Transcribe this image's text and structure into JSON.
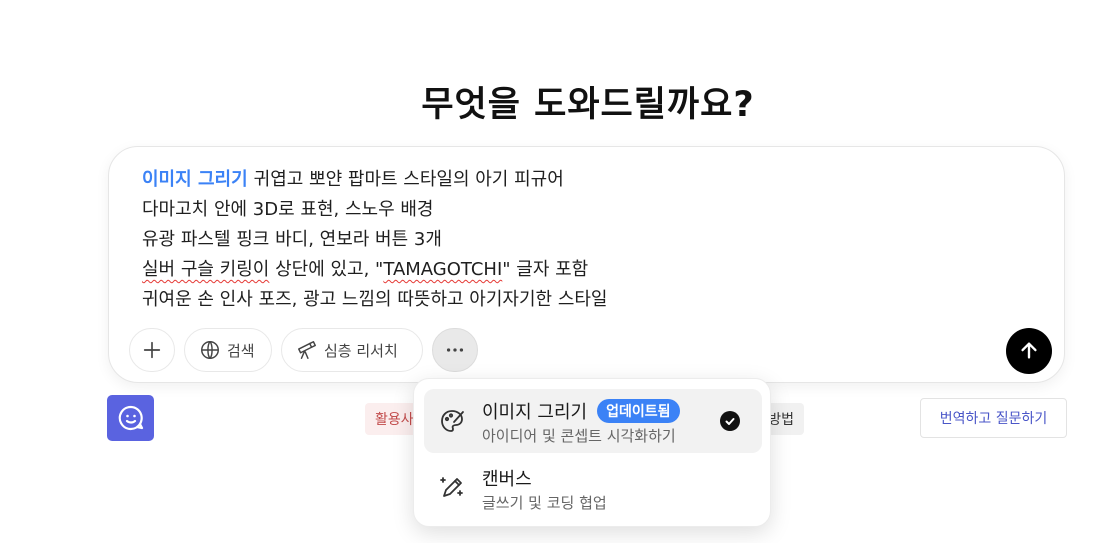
{
  "page": {
    "heading": "무엇을 도와드릴까요?"
  },
  "composer": {
    "tag": "이미지 그리기",
    "line1_rest": "귀엽고 뽀얀 팝마트 스타일의 아기 피규어",
    "line2": "다마고치 안에 3D로 표현, 스노우 배경",
    "line3": "유광 파스텔 핑크 바디, 연보라 버튼 3개",
    "line4_a": "실버 구슬 키링이",
    "line4_b": " 상단에 있고, \"",
    "line4_c": "TAMAGOTCHI",
    "line4_d": "\" 글자 포함",
    "line5": "귀여운 손 인사 포즈, 광고 느낌의 따뜻하고 아기자기한 스타일",
    "tools": {
      "plus_icon": "plus-icon",
      "search_label": "검색",
      "search_icon": "globe-icon",
      "research_label": "심층 리서치",
      "research_icon": "telescope-icon",
      "more_icon": "more-dots-icon",
      "send_icon": "arrow-up-icon"
    }
  },
  "below": {
    "usage_pill": "활용사",
    "method_pill": "방법",
    "translate_button": "번역하고 질문하기"
  },
  "menu": {
    "items": [
      {
        "title": "이미지 그리기",
        "badge": "업데이트됨",
        "desc": "아이디어 및 콘셉트 시각화하기",
        "icon": "paint-palette-icon",
        "selected": true
      },
      {
        "title": "캔버스",
        "desc": "글쓰기 및 코딩 협업",
        "icon": "magic-pen-icon",
        "selected": false
      }
    ]
  },
  "colors": {
    "accent_blue": "#3b82f6",
    "bot_tile": "#5a63e0",
    "translate_text": "#4a56c8",
    "usage_text": "#c24b4b"
  }
}
